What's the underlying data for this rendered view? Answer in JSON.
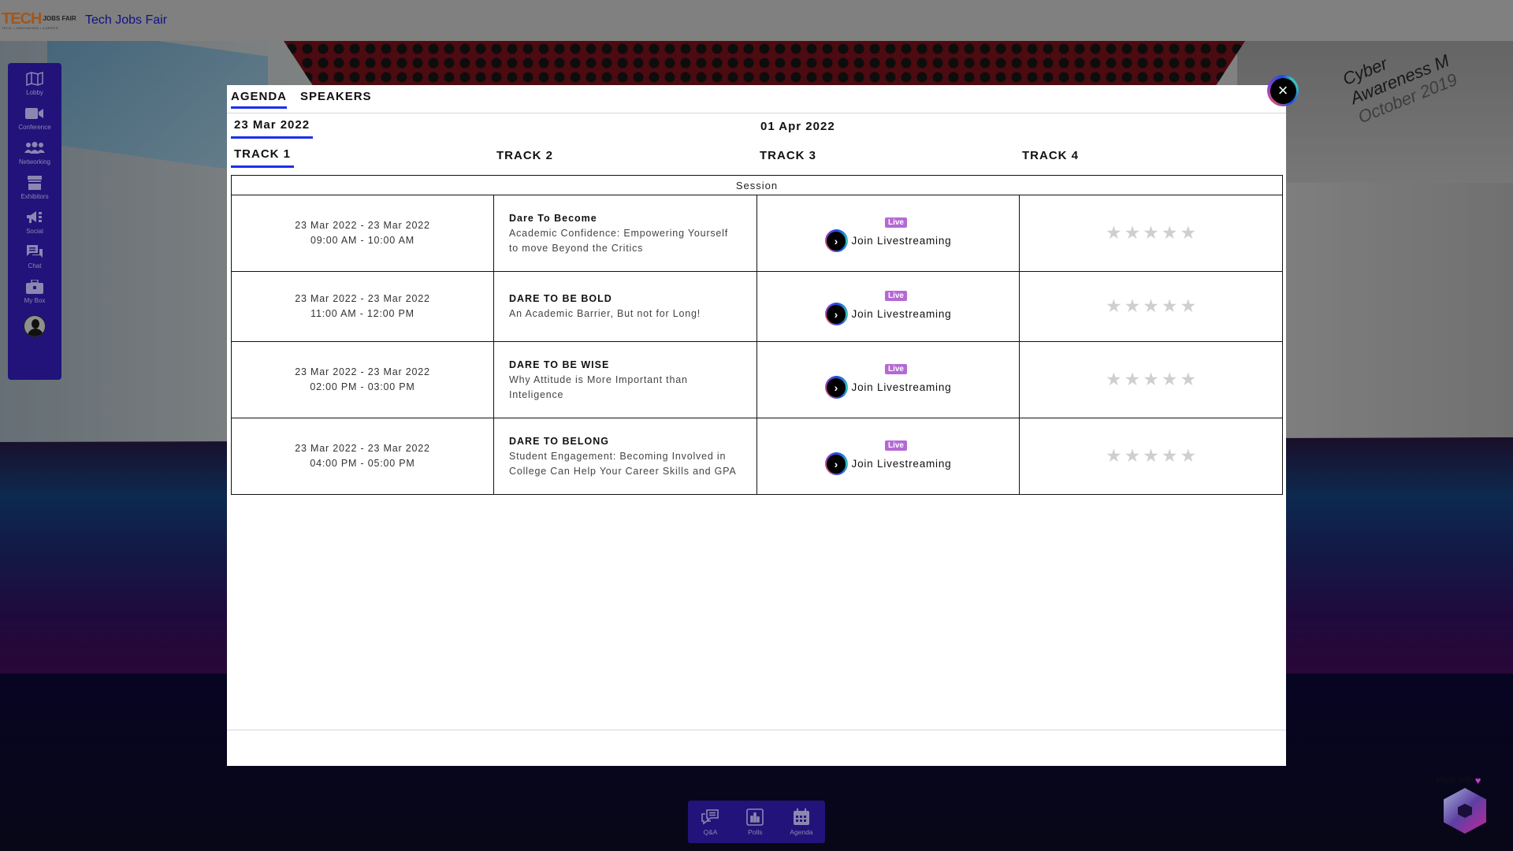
{
  "header": {
    "logo_main": "TECH",
    "logo_side": "JOBS FAIR",
    "logo_tagline": "TECH • INNOVATION • CAREER",
    "site_title": "Tech Jobs Fair"
  },
  "sidebar": {
    "items": [
      {
        "label": "Lobby",
        "icon": "map-icon"
      },
      {
        "label": "Conference",
        "icon": "video-camera-icon"
      },
      {
        "label": "Networking",
        "icon": "people-group-icon"
      },
      {
        "label": "Exhibitors",
        "icon": "booth-icon"
      },
      {
        "label": "Social",
        "icon": "megaphone-icon"
      },
      {
        "label": "Chat",
        "icon": "chat-bubbles-icon"
      },
      {
        "label": "My Box",
        "icon": "briefcase-icon"
      }
    ],
    "avatar": "user-avatar"
  },
  "modal": {
    "tabs": [
      {
        "label": "AGENDA",
        "active": true
      },
      {
        "label": "SPEAKERS",
        "active": false
      }
    ],
    "dates": [
      {
        "label": "23 Mar 2022",
        "active": true
      },
      {
        "label": "01 Apr 2022",
        "active": false
      }
    ],
    "tracks": [
      {
        "label": "TRACK 1",
        "active": true
      },
      {
        "label": "TRACK 2",
        "active": false
      },
      {
        "label": "TRACK 3",
        "active": false
      },
      {
        "label": "TRACK 4",
        "active": false
      }
    ],
    "table_header": "Session",
    "close_icon": "×",
    "sessions": [
      {
        "date_range": "23 Mar 2022 - 23 Mar 2022",
        "time_range": "09:00 AM - 10:00 AM",
        "title": "Dare To Become",
        "description": "Academic Confidence: Empowering Yourself to move Beyond the Critics",
        "badge": "Live",
        "action": "Join Livestreaming",
        "rating": 0,
        "rating_max": 5
      },
      {
        "date_range": "23 Mar 2022 - 23 Mar 2022",
        "time_range": "11:00 AM - 12:00 PM",
        "title": "DARE TO BE BOLD",
        "description": "An Academic Barrier, But not for Long!",
        "badge": "Live",
        "action": "Join Livestreaming",
        "rating": 0,
        "rating_max": 5
      },
      {
        "date_range": "23 Mar 2022 - 23 Mar 2022",
        "time_range": "02:00 PM - 03:00 PM",
        "title": "DARE TO BE WISE",
        "description": "Why Attitude is More Important than Inteligence",
        "badge": "Live",
        "action": "Join Livestreaming",
        "rating": 0,
        "rating_max": 5
      },
      {
        "date_range": "23 Mar 2022 - 23 Mar 2022",
        "time_range": "04:00 PM - 05:00 PM",
        "title": "DARE TO BELONG",
        "description": "Student Engagement: Becoming Involved in College Can Help Your Career Skills and GPA",
        "badge": "Live",
        "action": "Join Livestreaming",
        "rating": 0,
        "rating_max": 5
      }
    ]
  },
  "bottom_bar": {
    "items": [
      {
        "label": "Q&A",
        "icon": "qa-bubbles-icon"
      },
      {
        "label": "Polls",
        "icon": "bar-chart-icon"
      },
      {
        "label": "Agenda",
        "icon": "calendar-icon"
      }
    ]
  },
  "branding": {
    "made_with": "Made With",
    "heart": "♥"
  },
  "background": {
    "poster_text_1": "Cyber",
    "poster_text_2": "Awareness M",
    "poster_text_3": "October 2019"
  },
  "colors": {
    "accent_underline": "#1a2ff0",
    "sidebar_bg": "#21137a",
    "live_badge": "#b469d3",
    "star_empty": "#cfcfcf",
    "site_title": "#10108a"
  }
}
